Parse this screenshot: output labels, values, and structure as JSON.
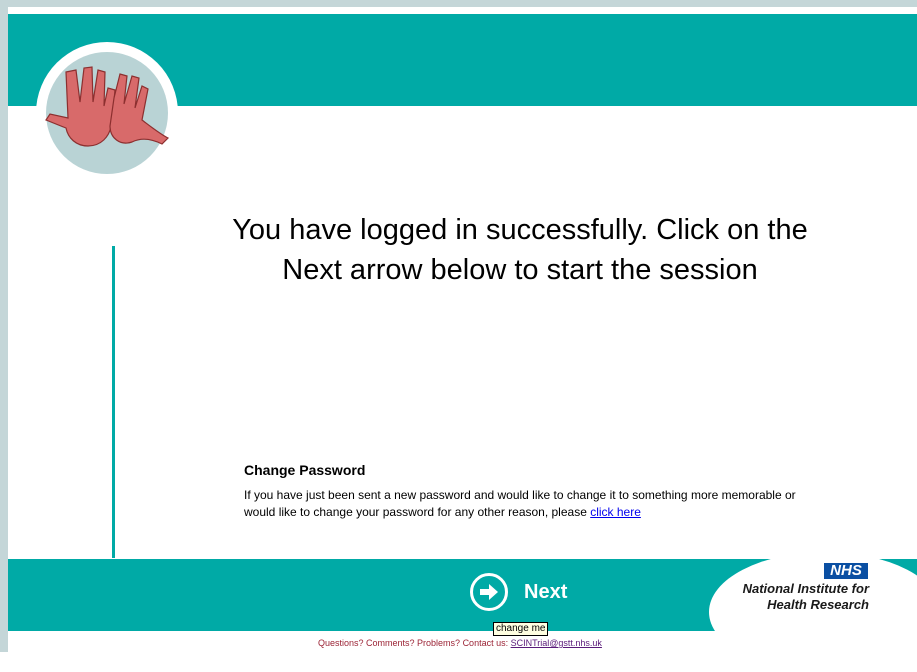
{
  "header": {
    "logo_icon": "hands-logo-icon"
  },
  "main": {
    "headline": "You have logged in successfully. Click on the Next arrow below to start the session"
  },
  "change_password": {
    "title": "Change Password",
    "text": "If you have just been sent a new password and would like to change it to something more memorable or would like to change your password for any other reason, please",
    "link": "click here"
  },
  "footer": {
    "next_label": "Next",
    "next_icon": "arrow-right-circle-icon",
    "tooltip": "change me",
    "nhs": "NHS",
    "nihr_line1": "National Institute for",
    "nihr_line2": "Health Research",
    "contact_text": "Questions? Comments? Problems? Contact us:",
    "contact_email": "SCINTrial@gstt.nhs.uk"
  },
  "colors": {
    "teal": "#00aaa6",
    "link_blue": "#0000ee",
    "nhs_blue": "#0a4fa3",
    "footer_text": "#9b2335"
  }
}
